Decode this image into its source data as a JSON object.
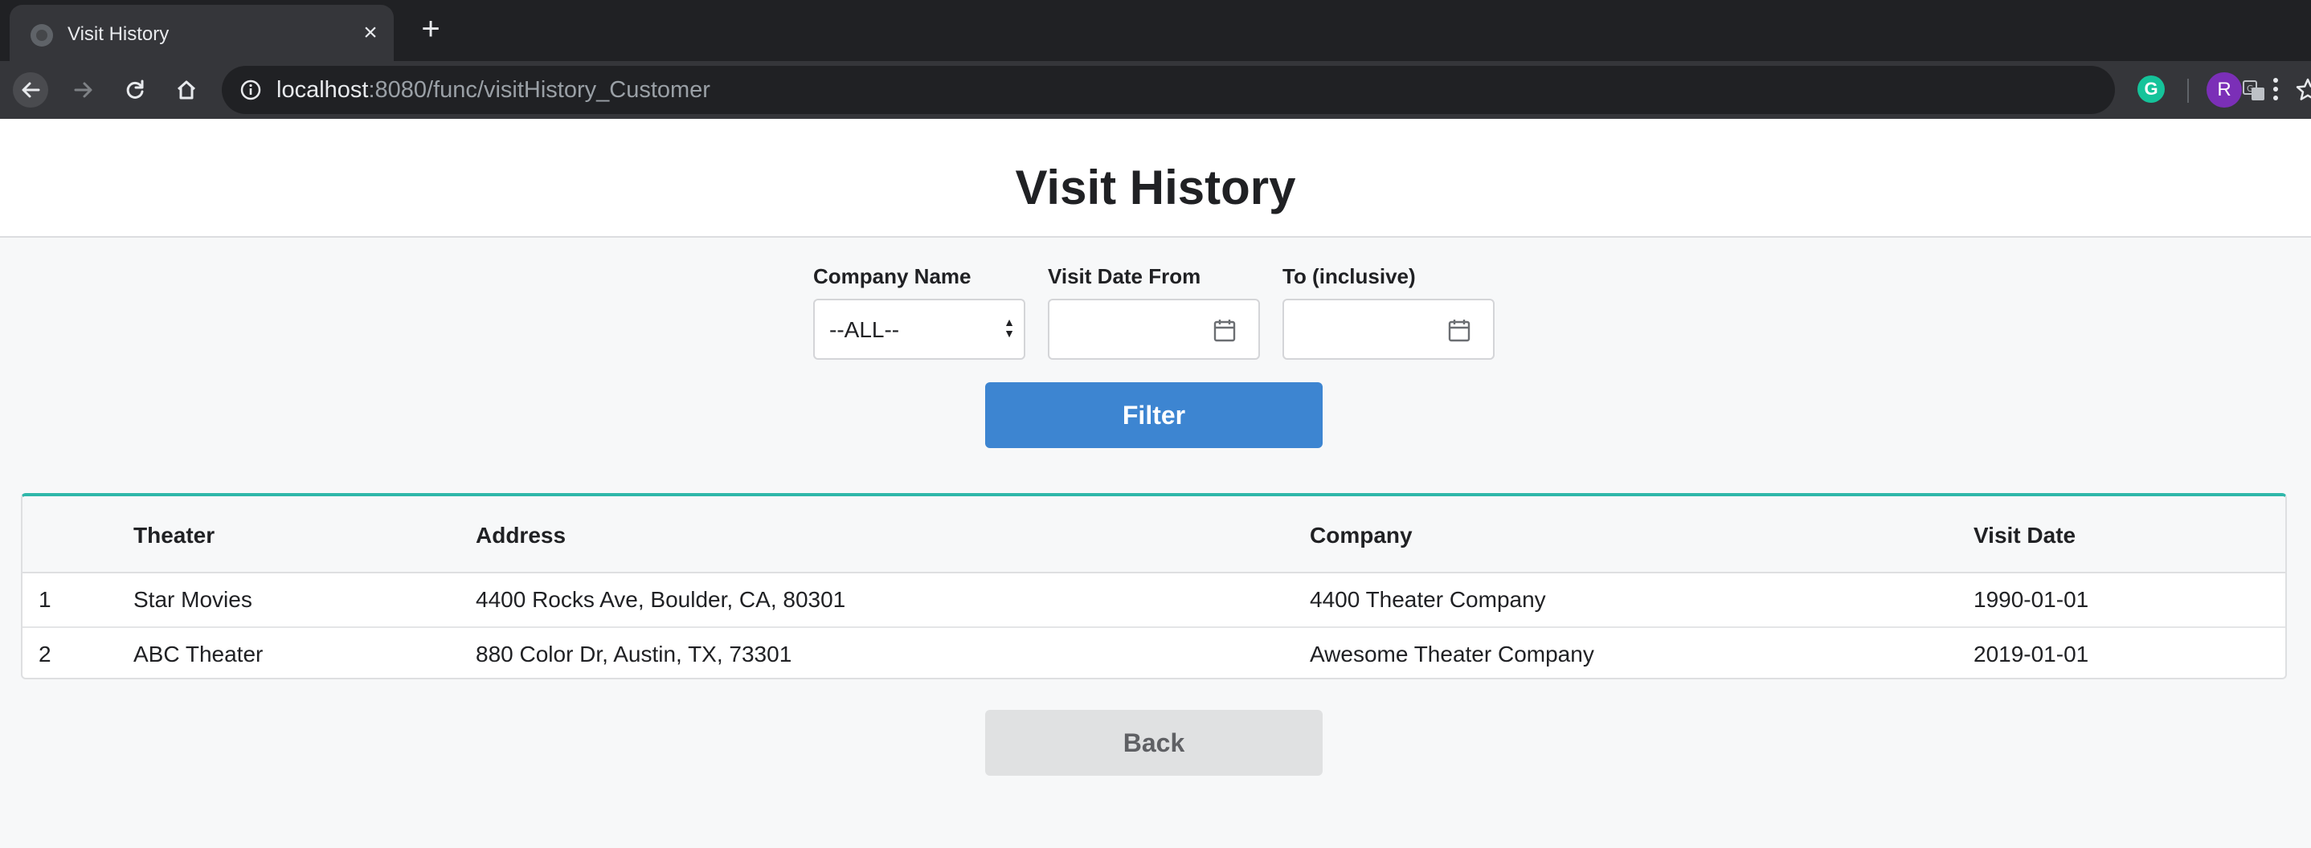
{
  "browser": {
    "tab_title": "Visit History",
    "tab_close": "×",
    "new_tab": "+",
    "url_host": "localhost",
    "url_path": ":8080/func/visitHistory_Customer",
    "profile_initial": "R",
    "grammarly_letter": "G"
  },
  "page": {
    "title": "Visit History"
  },
  "filters": {
    "company_label": "Company Name",
    "company_value": "--ALL--",
    "date_from_label": "Visit Date From",
    "date_to_label": "To (inclusive)",
    "filter_button": "Filter"
  },
  "table": {
    "headers": [
      "",
      "Theater",
      "Address",
      "Company",
      "Visit Date"
    ],
    "rows": [
      [
        "1",
        "Star Movies",
        "4400 Rocks Ave, Boulder, CA, 80301",
        "4400 Theater Company",
        "1990-01-01"
      ],
      [
        "2",
        "ABC Theater",
        "880 Color Dr, Austin, TX, 73301",
        "Awesome Theater Company",
        "2019-01-01"
      ]
    ]
  },
  "back_button": "Back",
  "colors": {
    "accent": "#3d85d1",
    "table_top_border": "#2fb7aa"
  }
}
